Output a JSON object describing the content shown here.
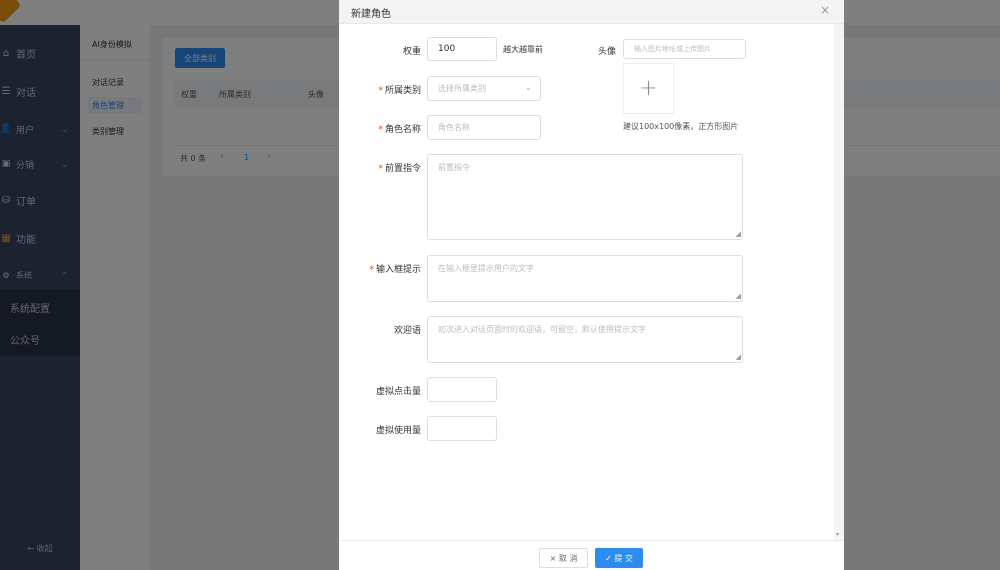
{
  "sidebar": {
    "items": [
      {
        "icon": "home-icon",
        "glyph": "⌂",
        "label": "首页"
      },
      {
        "icon": "list-icon",
        "glyph": "☰",
        "label": "对话"
      },
      {
        "icon": "user-icon",
        "glyph": "👤",
        "label": "用户",
        "chevron": "⌄"
      },
      {
        "icon": "share-icon",
        "glyph": "▣",
        "label": "分销",
        "chevron": "⌄"
      },
      {
        "icon": "order-icon",
        "glyph": "⛁",
        "label": "订单"
      },
      {
        "icon": "grid-icon",
        "glyph": "▦",
        "label": "功能"
      },
      {
        "icon": "gear-icon",
        "glyph": "⚙",
        "label": "系统",
        "chevron": "⌃"
      }
    ],
    "sub_items": [
      "系统配置",
      "公众号"
    ],
    "collapse": "← 收起"
  },
  "subcol": {
    "title": "AI身份模拟",
    "items": [
      "对话记录",
      "角色管理",
      "类别管理"
    ],
    "active": 1
  },
  "main": {
    "all_categories": "全部类别",
    "columns": [
      "权重",
      "所属类别",
      "头像"
    ],
    "total": "共 0 条",
    "page": "1",
    "prev": "‹",
    "next": "›"
  },
  "modal": {
    "title": "新建角色",
    "close": "×",
    "weight": {
      "label": "权重",
      "value": "100",
      "hint": "越大越靠前"
    },
    "avatar": {
      "label": "头像",
      "placeholder": "输入图片地址或上传图片",
      "plus": "+",
      "hint": "建议100x100像素，正方形图片"
    },
    "category": {
      "label": "所属类别",
      "placeholder": "选择所属类别"
    },
    "name": {
      "label": "角色名称",
      "placeholder": "角色名称"
    },
    "prompt": {
      "label": "前置指令",
      "placeholder": "前置指令"
    },
    "input_hint": {
      "label": "输入框提示",
      "placeholder": "在输入框里提示用户的文字"
    },
    "welcome": {
      "label": "欢迎语",
      "placeholder": "初次进入对话页面时的欢迎语，可留空，默认使用提示文字"
    },
    "clicks": {
      "label": "虚拟点击量",
      "value": ""
    },
    "uses": {
      "label": "虚拟使用量",
      "value": ""
    },
    "cancel": "× 取 消",
    "submit": "✓ 提 交",
    "required_mark": "*"
  },
  "colors": {
    "primary": "#2d8cf0",
    "sidebar": "#384460",
    "required": "#ed4014"
  }
}
